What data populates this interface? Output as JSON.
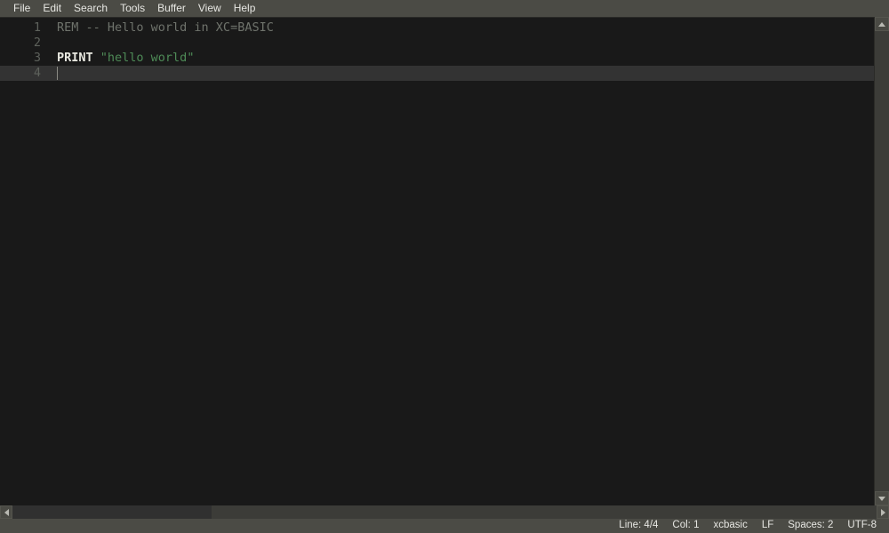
{
  "menubar": {
    "items": [
      {
        "label": "File"
      },
      {
        "label": "Edit"
      },
      {
        "label": "Search"
      },
      {
        "label": "Tools"
      },
      {
        "label": "Buffer"
      },
      {
        "label": "View"
      },
      {
        "label": "Help"
      }
    ]
  },
  "editor": {
    "lines": [
      {
        "number": "1",
        "current": false,
        "tokens": [
          {
            "text": "REM -- Hello world in XC=BASIC",
            "type": "comment"
          }
        ]
      },
      {
        "number": "2",
        "current": false,
        "tokens": []
      },
      {
        "number": "3",
        "current": false,
        "tokens": [
          {
            "text": "PRINT",
            "type": "keyword"
          },
          {
            "text": " ",
            "type": "plain"
          },
          {
            "text": "\"hello world\"",
            "type": "string"
          }
        ]
      },
      {
        "number": "4",
        "current": true,
        "tokens": []
      }
    ],
    "colors": {
      "background": "#191919",
      "current_line": "#333333",
      "gutter_text": "#5e625c",
      "comment": "#6f736c",
      "keyword": "#e8e8e0",
      "string": "#4e8b57",
      "cursor": "#8a8a84"
    }
  },
  "scrollbars": {
    "vertical": {
      "up_icon": "triangle-up-icon",
      "down_icon": "triangle-down-icon"
    },
    "horizontal": {
      "left_icon": "triangle-left-icon",
      "right_icon": "triangle-right-icon"
    }
  },
  "statusbar": {
    "items": [
      {
        "label": "Line: 4/4",
        "name": "status-line"
      },
      {
        "label": "Col: 1",
        "name": "status-column"
      },
      {
        "label": "xcbasic",
        "name": "status-language"
      },
      {
        "label": "LF",
        "name": "status-line-ending"
      },
      {
        "label": "Spaces: 2",
        "name": "status-indent"
      },
      {
        "label": "UTF-8",
        "name": "status-encoding"
      }
    ]
  }
}
